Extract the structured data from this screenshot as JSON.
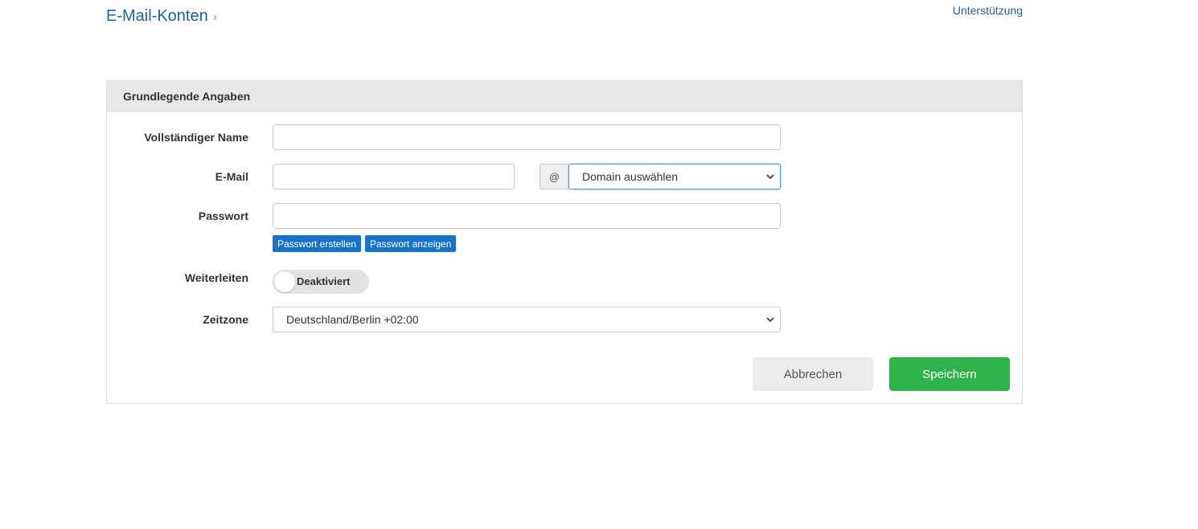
{
  "breadcrumb": {
    "current": "E-Mail-Konten",
    "separator": "›"
  },
  "header_links": {
    "support": "Unterstützung"
  },
  "panel": {
    "title": "Grundlegende Angaben"
  },
  "form": {
    "full_name": {
      "label": "Vollständiger Name",
      "value": ""
    },
    "email": {
      "label": "E-Mail",
      "value": "",
      "at_symbol": "@",
      "domain_selected": "Domain auswählen"
    },
    "password": {
      "label": "Passwort",
      "value": "",
      "generate_label": "Passwort erstellen",
      "show_label": "Passwort anzeigen"
    },
    "forwarding": {
      "label": "Weiterleiten",
      "state_label": "Deaktiviert",
      "enabled": false
    },
    "timezone": {
      "label": "Zeitzone",
      "selected": "Deutschland/Berlin +02:00"
    }
  },
  "actions": {
    "cancel_label": "Abbrechen",
    "save_label": "Speichern"
  },
  "colors": {
    "link": "#1f5f9b",
    "primary_small_button": "#1a73c9",
    "save_button": "#2db34a",
    "cancel_button": "#ececec",
    "panel_header": "#e8e8e8"
  }
}
